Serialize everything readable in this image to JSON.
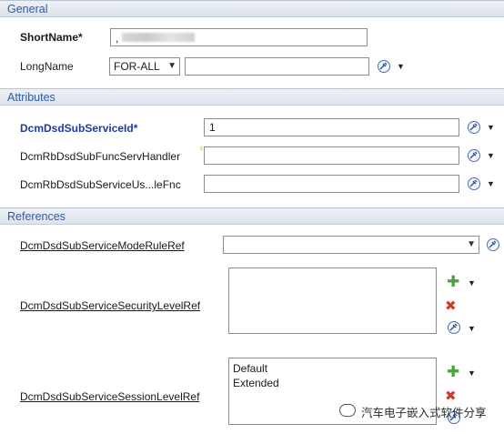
{
  "sections": {
    "general": "General",
    "attributes": "Attributes",
    "references": "References"
  },
  "general": {
    "short_name_label": "ShortName*",
    "short_name_value": ",",
    "long_name_label": "LongName",
    "long_name_lang": "FOR-ALL",
    "long_name_value": ""
  },
  "attributes": {
    "sub_service_id_label": "DcmDsdSubServiceId*",
    "sub_service_id_value": "1",
    "func_handler_label": "DcmRbDsdSubFuncServHandler",
    "func_handler_value": "",
    "us_fnc_label": "DcmRbDsdSubServiceUs...leFnc",
    "us_fnc_value": ""
  },
  "references": {
    "mode_rule_label": "DcmDsdSubServiceModeRuleRef",
    "mode_rule_value": "",
    "security_level_label": "DcmDsdSubServiceSecurityLevelRef",
    "security_items": [],
    "session_level_label": "DcmDsdSubServiceSessionLevelRef",
    "session_items": [
      "Default",
      "Extended"
    ]
  },
  "icons": {
    "add": "plus-icon",
    "remove": "delete-icon",
    "tool": "wrench-icon",
    "dropdown": "chevron-down-icon"
  },
  "watermark": {
    "text": "汽车电子嵌入式软件分享"
  },
  "colors": {
    "section_text": "#2e5aa8",
    "mandatory_label": "#1f3aa8",
    "add": "#4aa53c",
    "remove": "#d23a2a"
  }
}
